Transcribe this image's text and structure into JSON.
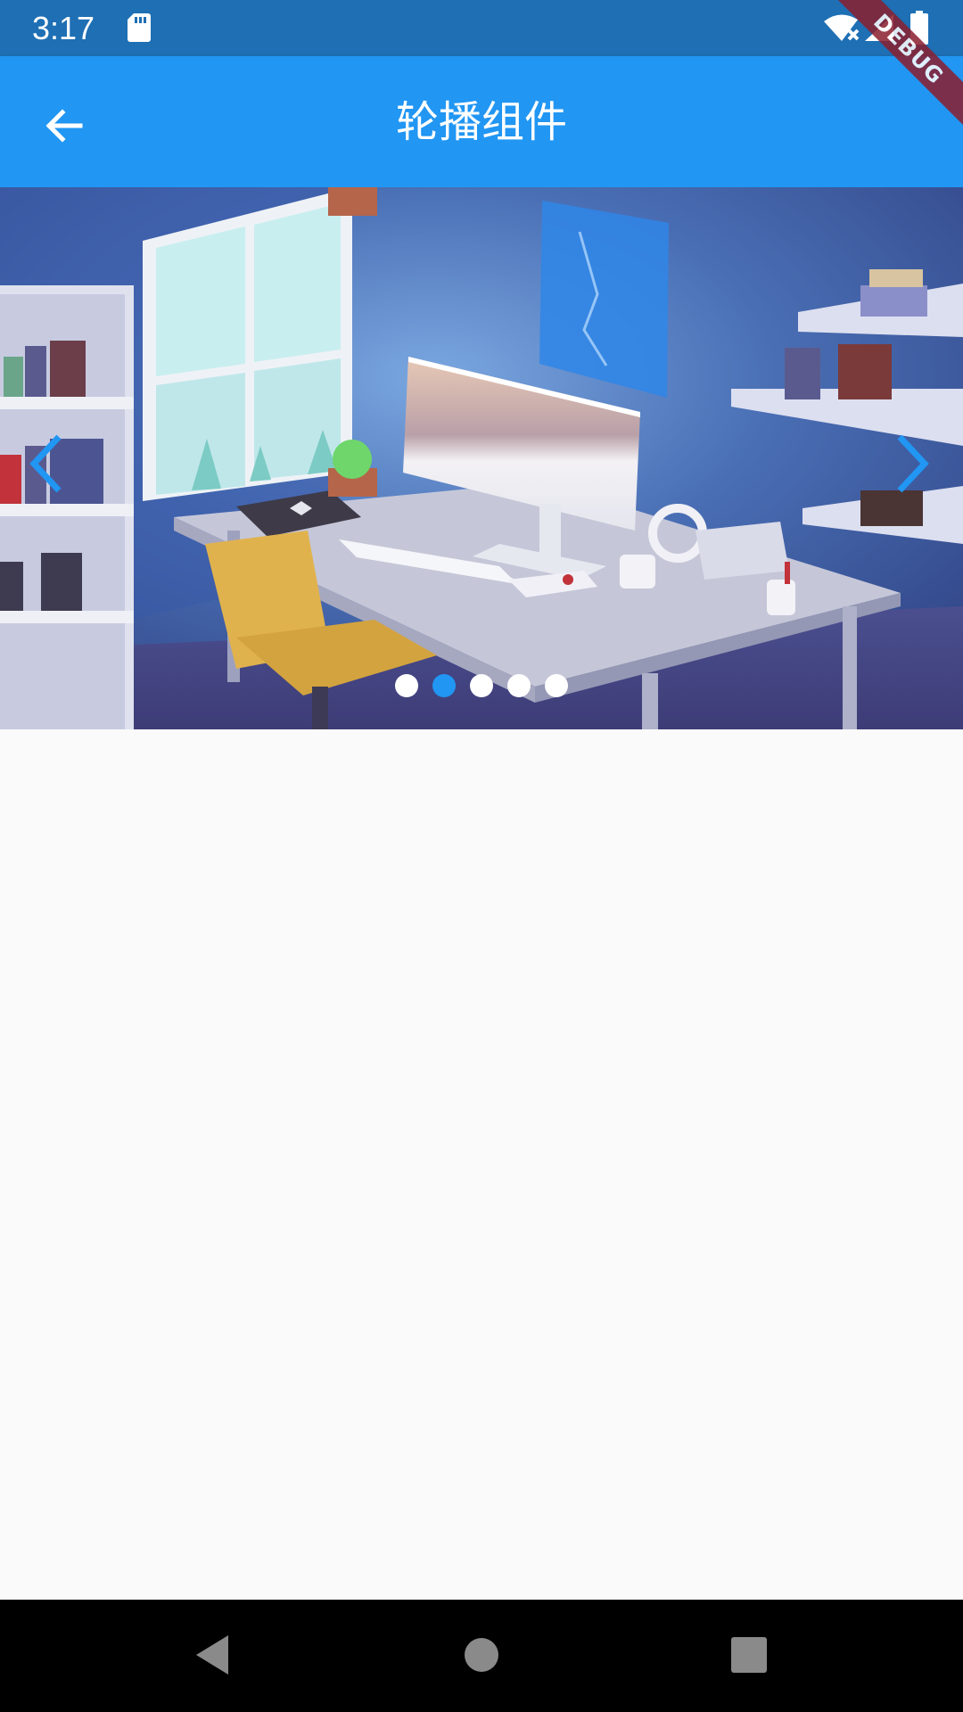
{
  "status_bar": {
    "time": "3:17",
    "icons": [
      "sd-card-icon",
      "wifi-off-icon",
      "signal-icon",
      "battery-icon"
    ]
  },
  "debug_banner": {
    "label": "DEBUG"
  },
  "app_bar": {
    "title": "轮播组件",
    "back_icon": "arrow-back-icon",
    "color": "#2196f3"
  },
  "carousel": {
    "image": "desk-workspace-illustration",
    "prev_icon": "chevron-left-icon",
    "next_icon": "chevron-right-icon",
    "page_count": 5,
    "active_index": 1,
    "active_dot_color": "#2196f3",
    "inactive_dot_color": "#ffffff"
  },
  "system_nav": {
    "icons": [
      "nav-back-icon",
      "nav-home-icon",
      "nav-recents-icon"
    ]
  }
}
